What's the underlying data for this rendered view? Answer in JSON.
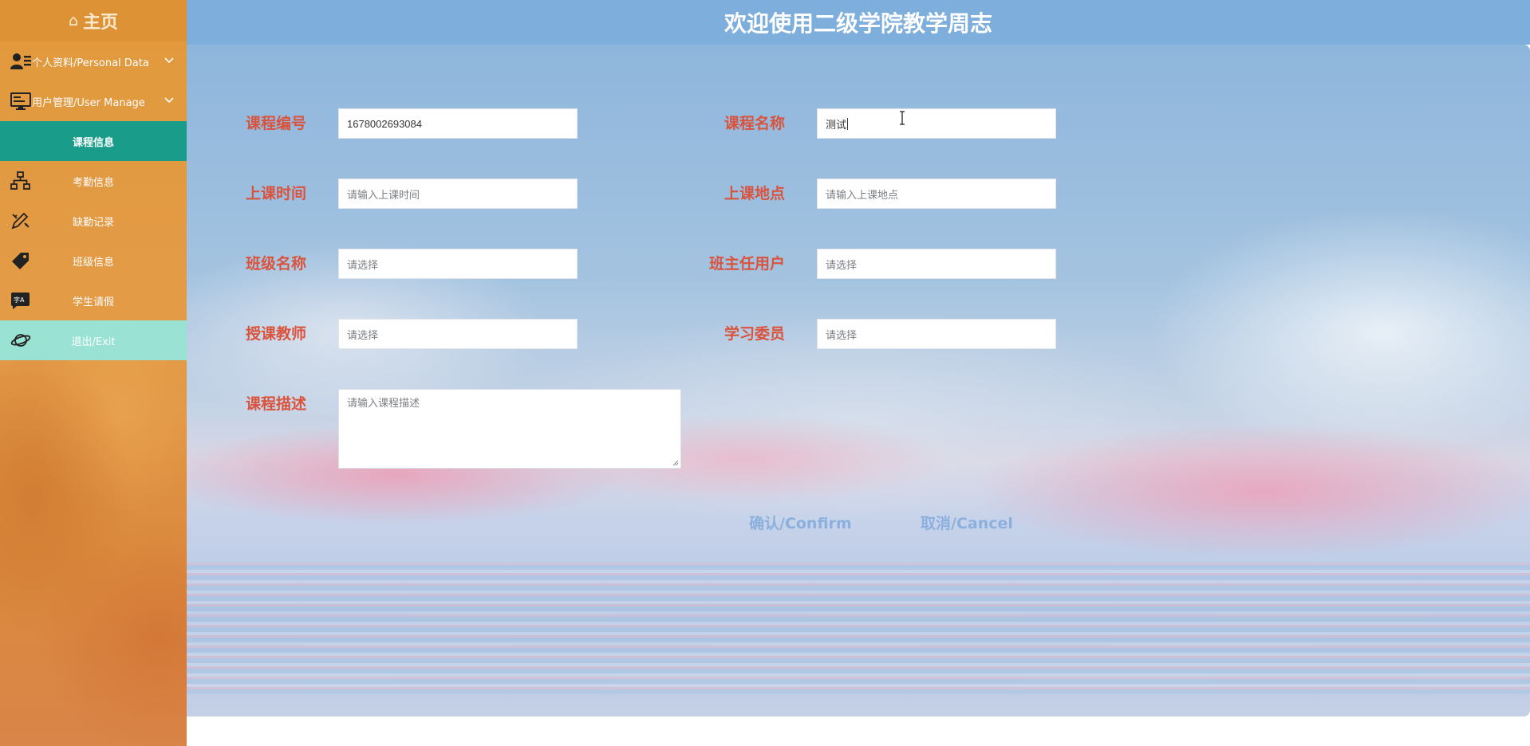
{
  "sidebar": {
    "home_label": "主页",
    "items": [
      {
        "label": "个人资料/Personal Data",
        "icon": "user-profile-icon"
      },
      {
        "label": "用户管理/User Manage",
        "icon": "monitor-icon"
      },
      {
        "label": "课程信息"
      },
      {
        "label": "考勤信息",
        "icon": "hierarchy-icon"
      },
      {
        "label": "缺勤记录",
        "icon": "pencil-ruler-icon"
      },
      {
        "label": "班级信息",
        "icon": "tag-icon"
      },
      {
        "label": "学生请假",
        "icon": "translate-icon"
      },
      {
        "label": "退出/Exit",
        "icon": "planet-icon"
      }
    ]
  },
  "header": {
    "title": "欢迎使用二级学院教学周志"
  },
  "form": {
    "course_no": {
      "label": "课程编号",
      "value": "1678002693084"
    },
    "course_name": {
      "label": "课程名称",
      "value": "测试"
    },
    "class_time": {
      "label": "上课时间",
      "placeholder": "请输入上课时间"
    },
    "class_place": {
      "label": "上课地点",
      "placeholder": "请输入上课地点"
    },
    "class_name": {
      "label": "班级名称",
      "placeholder": "请选择"
    },
    "head_teacher": {
      "label": "班主任用户",
      "placeholder": "请选择"
    },
    "teacher": {
      "label": "授课教师",
      "placeholder": "请选择"
    },
    "study_rep": {
      "label": "学习委员",
      "placeholder": "请选择"
    },
    "description": {
      "label": "课程描述",
      "placeholder": "请输入课程描述"
    }
  },
  "buttons": {
    "confirm": "确认/Confirm",
    "cancel": "取消/Cancel"
  },
  "colors": {
    "sidebar_bg": "#e2993c",
    "sidebar_active": "#1a9c8a",
    "sidebar_exit": "#99e2d4",
    "header_bg": "#7eaedb",
    "label_red": "#d9533d",
    "button_blue": "#8cb0dd"
  }
}
